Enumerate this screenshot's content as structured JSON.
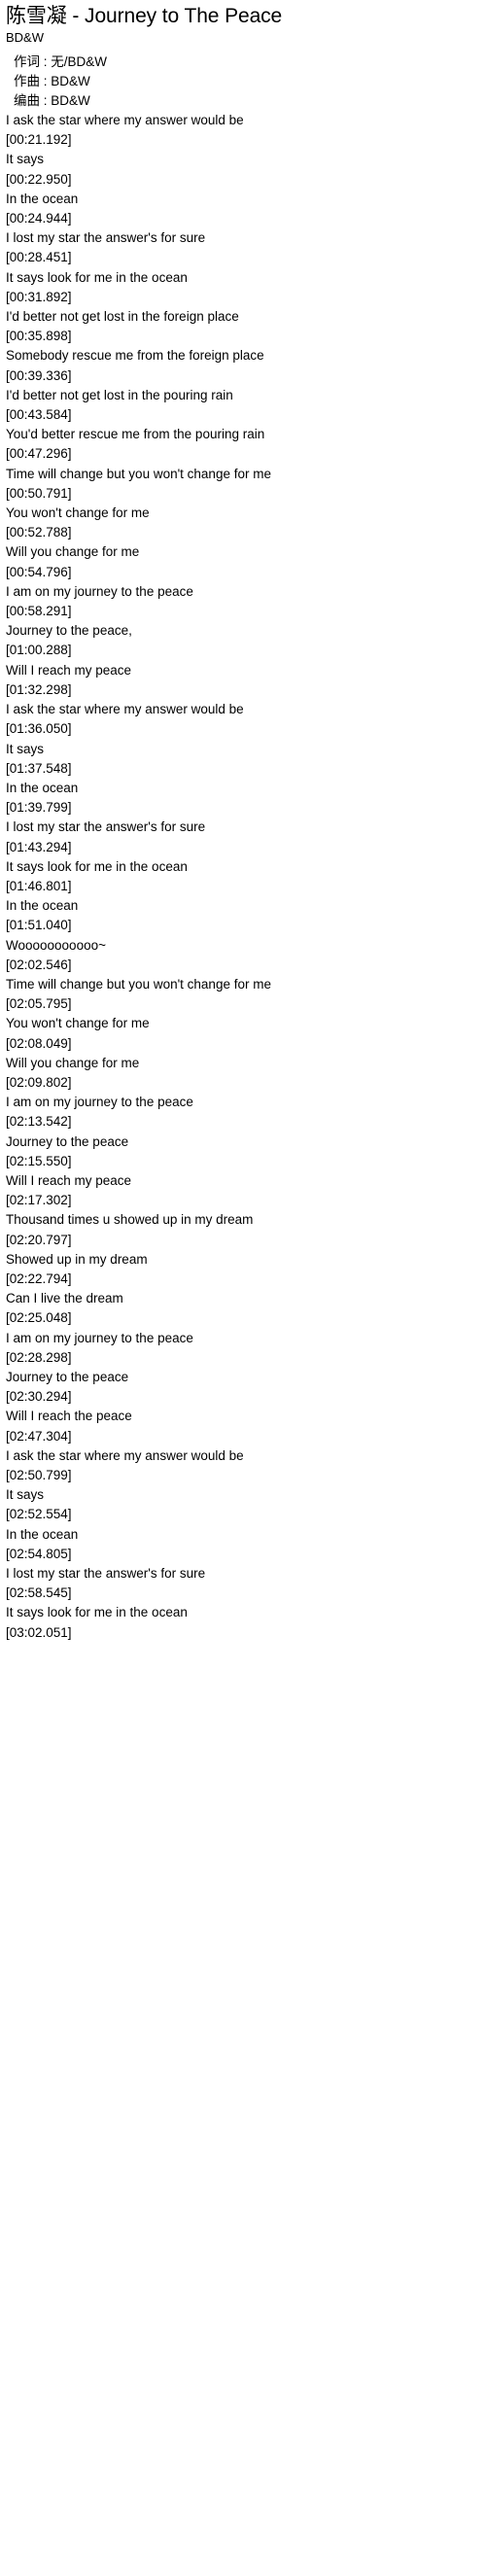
{
  "header": {
    "title": "陈雪凝 - Journey to The Peace",
    "artist": "BD&W"
  },
  "credits": [
    "作词 : 无/BD&W",
    "作曲 : BD&W",
    "编曲 : BD&W"
  ],
  "lyrics": [
    {
      "text": "I ask the star where my answer would be",
      "time": "[00:21.192]"
    },
    {
      "text": "It says",
      "time": "[00:22.950]"
    },
    {
      "text": "In the ocean",
      "time": "[00:24.944]"
    },
    {
      "text": "I lost my star the answer's for sure",
      "time": "[00:28.451]"
    },
    {
      "text": "It says look for me in the ocean",
      "time": "[00:31.892]"
    },
    {
      "text": "I'd better not get lost in the foreign place",
      "time": "[00:35.898]"
    },
    {
      "text": "Somebody rescue me from the foreign place",
      "time": "[00:39.336]"
    },
    {
      "text": "I'd better not get lost in the pouring rain",
      "time": "[00:43.584]"
    },
    {
      "text": "You'd better rescue me from the pouring rain",
      "time": "[00:47.296]"
    },
    {
      "text": "Time will change but you won't change for me",
      "time": "[00:50.791]"
    },
    {
      "text": "You won't change for me",
      "time": "[00:52.788]"
    },
    {
      "text": "Will you change for me",
      "time": "[00:54.796]"
    },
    {
      "text": "I am on my journey to the peace",
      "time": "[00:58.291]"
    },
    {
      "text": "Journey to the peace,",
      "time": "[01:00.288]"
    },
    {
      "text": "Will I reach my peace",
      "time": "[01:32.298]"
    },
    {
      "text": "I ask the star where my answer would be",
      "time": "[01:36.050]"
    },
    {
      "text": "It says",
      "time": "[01:37.548]"
    },
    {
      "text": "In the ocean",
      "time": "[01:39.799]"
    },
    {
      "text": "I lost my star the answer's for sure",
      "time": "[01:43.294]"
    },
    {
      "text": "It says look for me in the ocean",
      "time": "[01:46.801]"
    },
    {
      "text": "In the ocean",
      "time": "[01:51.040]"
    },
    {
      "text": "Wooooooooooo~",
      "time": "[02:02.546]"
    },
    {
      "text": "Time will change but you won't change for me",
      "time": "[02:05.795]"
    },
    {
      "text": "You won't change for me",
      "time": "[02:08.049]"
    },
    {
      "text": "Will you change for me",
      "time": "[02:09.802]"
    },
    {
      "text": "I am on my journey to the peace",
      "time": "[02:13.542]"
    },
    {
      "text": "Journey to the peace",
      "time": "[02:15.550]"
    },
    {
      "text": "Will I reach my peace",
      "time": "[02:17.302]"
    },
    {
      "text": "Thousand times u showed up in my dream",
      "time": "[02:20.797]"
    },
    {
      "text": "Showed up in my dream",
      "time": "[02:22.794]"
    },
    {
      "text": "Can I live the dream",
      "time": "[02:25.048]"
    },
    {
      "text": "I am on my journey to the peace",
      "time": "[02:28.298]"
    },
    {
      "text": "Journey to the peace",
      "time": "[02:30.294]"
    },
    {
      "text": "Will I reach the peace",
      "time": "[02:47.304]"
    },
    {
      "text": "I ask the star where my answer would be",
      "time": "[02:50.799]"
    },
    {
      "text": "It says",
      "time": "[02:52.554]"
    },
    {
      "text": "In the ocean",
      "time": "[02:54.805]"
    },
    {
      "text": "I lost my star the answer's for sure",
      "time": "[02:58.545]"
    },
    {
      "text": "It says look for me in the ocean",
      "time": "[03:02.051]"
    }
  ]
}
